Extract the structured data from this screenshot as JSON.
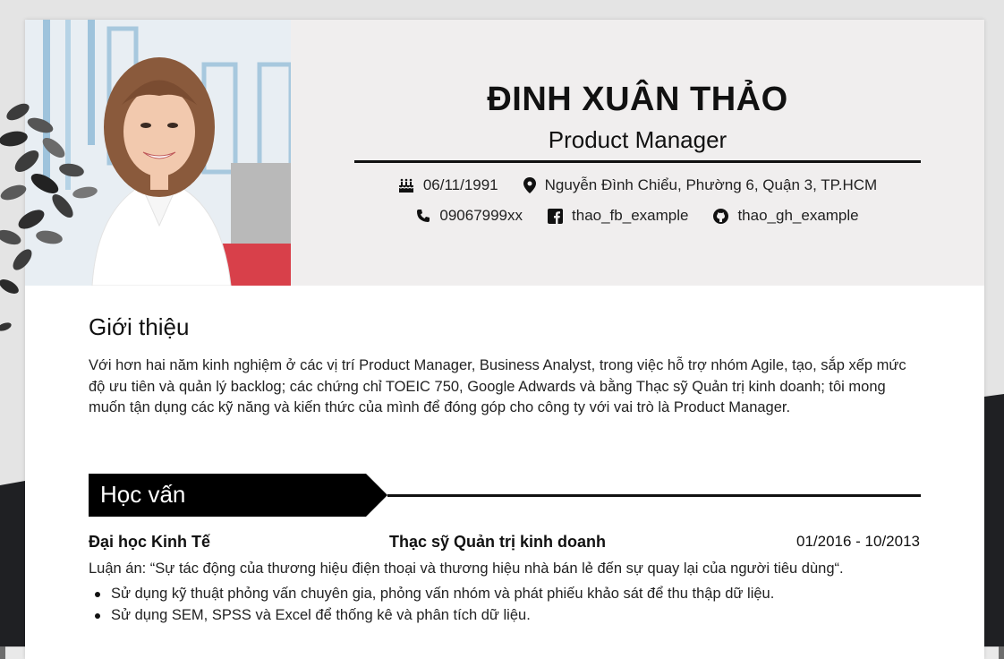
{
  "profile": {
    "name": "ĐINH XUÂN THẢO",
    "title": "Product Manager"
  },
  "contact": {
    "birthday": "06/11/1991",
    "address": "Nguyễn Đình Chiểu, Phường 6, Quận 3, TP.HCM",
    "phone": "09067999xx",
    "facebook": "thao_fb_example",
    "github": "thao_gh_example"
  },
  "icons": {
    "birthday": "birthday-cake-icon",
    "address": "map-pin-icon",
    "phone": "phone-icon",
    "facebook": "facebook-icon",
    "github": "github-icon"
  },
  "about": {
    "heading": "Giới thiệu",
    "text": "Với hơn hai năm kinh nghiệm ở các vị trí Product Manager, Business Analyst, trong việc hỗ trợ nhóm Agile, tạo, sắp xếp mức độ ưu tiên và quản lý backlog; các chứng chỉ TOEIC 750, Google Adwards và bằng Thạc sỹ Quản trị kinh doanh; tôi mong muốn tận dụng các kỹ năng và kiến thức của mình để đóng góp cho công ty với vai trò là Product Manager."
  },
  "education": {
    "heading": "Học vấn",
    "items": [
      {
        "school": "Đại học Kinh Tế",
        "degree": "Thạc sỹ Quản trị kinh doanh",
        "period": "01/2016 - 10/2013",
        "thesis": "Luận án: “Sự tác động của thương hiệu điện thoại và thương hiệu nhà bán lẻ đến sự quay lại của người tiêu dùng“.",
        "bullets": [
          "Sử dụng kỹ thuật phỏng vấn chuyên gia, phỏng vấn nhóm và phát phiếu khảo sát để thu thập dữ liệu.",
          "Sử dụng SEM, SPSS và Excel để thống kê và phân tích dữ liệu."
        ]
      }
    ]
  },
  "colors": {
    "header_bg": "#f0eeee",
    "banner_bg": "#000000",
    "page_bg": "#e4e4e4",
    "dark_band": "#1f2023"
  }
}
